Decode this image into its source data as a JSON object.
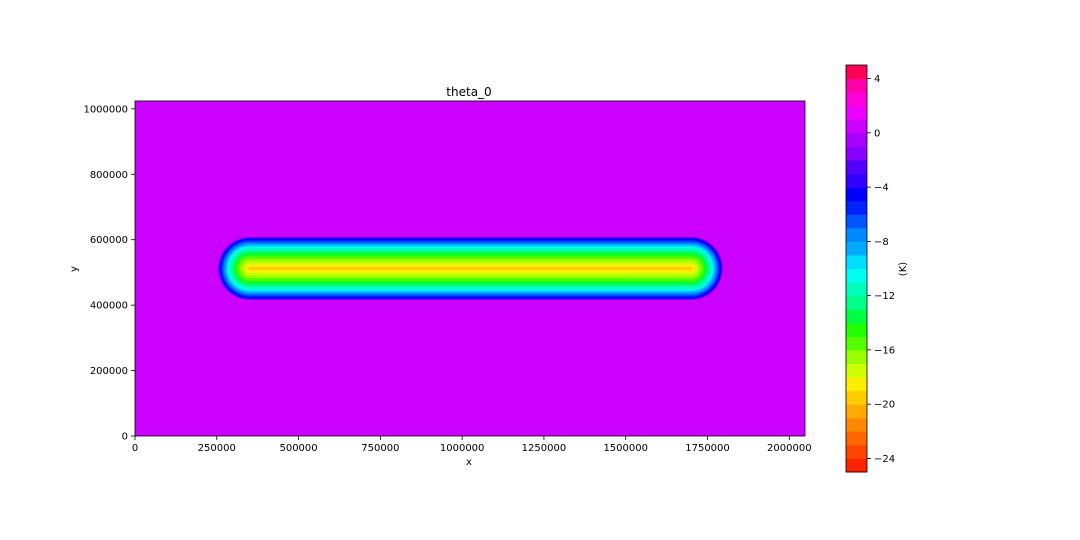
{
  "chart_data": {
    "type": "heatmap",
    "title": "theta_0",
    "xlabel": "x",
    "ylabel": "y",
    "xlim": [
      0,
      2048000
    ],
    "ylim": [
      0,
      1024000
    ],
    "x_ticks": [
      0,
      250000,
      500000,
      750000,
      1000000,
      1250000,
      1500000,
      1750000,
      2000000
    ],
    "y_ticks": [
      0,
      200000,
      400000,
      600000,
      800000,
      1000000
    ],
    "background_value": 0,
    "anomaly": {
      "shape": "horizontal band with rounded ends",
      "x_range": [
        250000,
        1800000
      ],
      "y_center": 512000,
      "half_width": 100000,
      "min_value": -20
    },
    "colorbar": {
      "label": "(K)",
      "vmin": -25,
      "vmax": 5,
      "ticks": [
        -24,
        -20,
        -16,
        -12,
        -8,
        -4,
        0,
        4
      ],
      "levels": [
        {
          "value": -25,
          "color": "#ff2200"
        },
        {
          "value": -24,
          "color": "#ff4400"
        },
        {
          "value": -23,
          "color": "#ff6600"
        },
        {
          "value": -22,
          "color": "#ff8800"
        },
        {
          "value": -21,
          "color": "#ffaa00"
        },
        {
          "value": -20,
          "color": "#ffcc00"
        },
        {
          "value": -19,
          "color": "#ffee00"
        },
        {
          "value": -18,
          "color": "#ccff00"
        },
        {
          "value": -17,
          "color": "#99ff00"
        },
        {
          "value": -16,
          "color": "#55ff00"
        },
        {
          "value": -15,
          "color": "#22ff00"
        },
        {
          "value": -14,
          "color": "#00ff44"
        },
        {
          "value": -13,
          "color": "#00ff88"
        },
        {
          "value": -12,
          "color": "#00ffbb"
        },
        {
          "value": -11,
          "color": "#00ffee"
        },
        {
          "value": -10,
          "color": "#00ddff"
        },
        {
          "value": -9,
          "color": "#00aaff"
        },
        {
          "value": -8,
          "color": "#0088ff"
        },
        {
          "value": -7,
          "color": "#0055ff"
        },
        {
          "value": -6,
          "color": "#0022ff"
        },
        {
          "value": -5,
          "color": "#0000ff"
        },
        {
          "value": -4,
          "color": "#3300ff"
        },
        {
          "value": -3,
          "color": "#5500ff"
        },
        {
          "value": -2,
          "color": "#8800ff"
        },
        {
          "value": -1,
          "color": "#aa00ff"
        },
        {
          "value": 0,
          "color": "#cc00ff"
        },
        {
          "value": 1,
          "color": "#ee00ff"
        },
        {
          "value": 2,
          "color": "#ff00dd"
        },
        {
          "value": 3,
          "color": "#ff00aa"
        },
        {
          "value": 4,
          "color": "#ff0055"
        }
      ]
    }
  }
}
